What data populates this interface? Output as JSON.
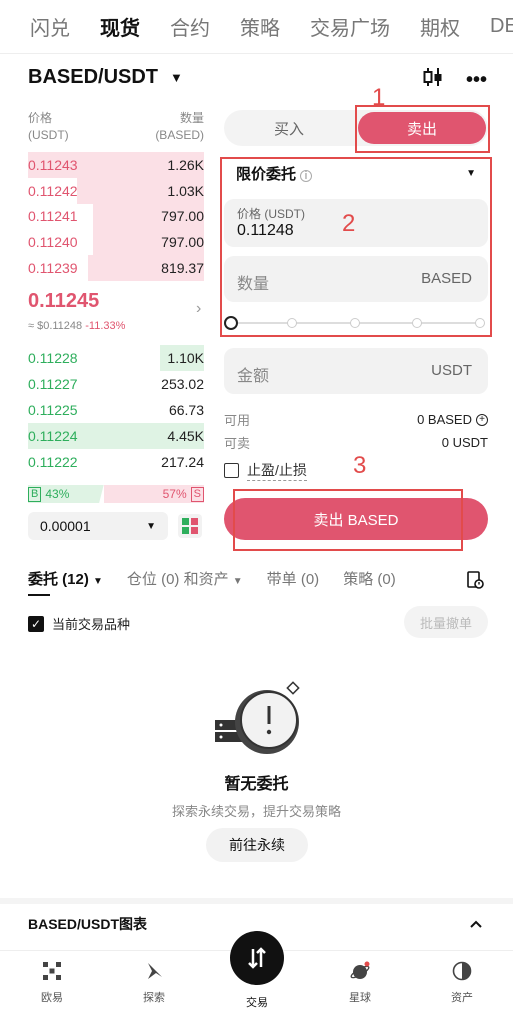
{
  "top_tabs": [
    "闪兑",
    "现货",
    "合约",
    "策略",
    "交易广场",
    "期权",
    "DE"
  ],
  "pair": "BASED/USDT",
  "orderbook": {
    "price_header": [
      "价格",
      "(USDT)"
    ],
    "amount_header": [
      "数量",
      "(BASED)"
    ],
    "asks": [
      {
        "price": "0.11243",
        "amount": "1.26K",
        "depth": 1.0
      },
      {
        "price": "0.11242",
        "amount": "1.03K",
        "depth": 0.72
      },
      {
        "price": "0.11241",
        "amount": "797.00",
        "depth": 0.63
      },
      {
        "price": "0.11240",
        "amount": "797.00",
        "depth": 0.63
      },
      {
        "price": "0.11239",
        "amount": "819.37",
        "depth": 0.66
      }
    ],
    "mid_price": "0.11245",
    "mid_sub": "≈ $0.11248",
    "mid_change": "-11.33%",
    "bids": [
      {
        "price": "0.11228",
        "amount": "1.10K",
        "depth": 0.25
      },
      {
        "price": "0.11227",
        "amount": "253.02",
        "depth": 0.0
      },
      {
        "price": "0.11225",
        "amount": "66.73",
        "depth": 0.0
      },
      {
        "price": "0.11224",
        "amount": "4.45K",
        "depth": 1.0
      },
      {
        "price": "0.11222",
        "amount": "217.24",
        "depth": 0.0
      }
    ],
    "buy_tag": "B",
    "buy_ratio": "43%",
    "sell_ratio": "57%",
    "sell_tag": "S",
    "depth_value": "0.00001"
  },
  "trade_panel": {
    "buy_label": "买入",
    "sell_label": "卖出",
    "order_type": "限价委托",
    "price_label": "价格 (USDT)",
    "price_value": "0.11248",
    "qty_label": "数量",
    "qty_unit": "BASED",
    "amount_label": "金额",
    "amount_unit": "USDT",
    "available_label": "可用",
    "available_value": "0 BASED",
    "sellable_label": "可卖",
    "sellable_value": "0 USDT",
    "tpsl_label": "止盈/止损",
    "sell_button": "卖出 BASED"
  },
  "annotations": [
    "1",
    "2",
    "3"
  ],
  "orders": {
    "tabs": [
      "委托 (12)",
      "仓位 (0) 和资产",
      "带单 (0)",
      "策略 (0)"
    ],
    "current_pair_label": "当前交易品种",
    "batch_cancel": "批量撤单",
    "empty_title": "暂无委托",
    "empty_sub": "探索永续交易，提升交易策略",
    "go_button": "前往永续"
  },
  "chart_bar_label": "BASED/USDT图表",
  "bottom_nav": [
    "欧易",
    "探索",
    "交易",
    "星球",
    "资产"
  ],
  "colors": {
    "ask": "#e0556f",
    "bid": "#2eae5c",
    "ask_bg": "#fbe0e6",
    "bid_bg": "#dff3e4",
    "annotation": "#e24b4b"
  }
}
